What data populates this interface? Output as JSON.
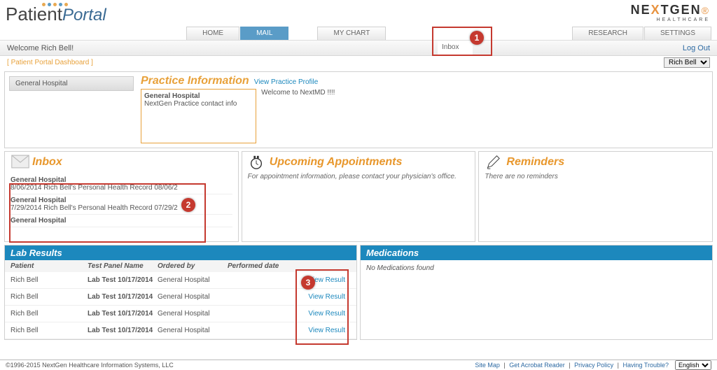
{
  "brand": {
    "nextgen": "NEXTGEN",
    "sub": "HEALTHCARE",
    "logo_patient": "Patient",
    "logo_portal": "Portal"
  },
  "nav": {
    "home": "HOME",
    "mail": "MAIL",
    "mychart": "MY CHART",
    "research": "RESEARCH",
    "settings": "SETTINGS",
    "inbox_sub": "Inbox"
  },
  "welcome": {
    "text": "Welcome Rich Bell!",
    "logout": "Log Out"
  },
  "breadcrumb": {
    "open": "[ ",
    "label": "Patient Portal Dashboard",
    "close": " ]",
    "user": "Rich Bell"
  },
  "practice": {
    "tab": "General Hospital",
    "title": "Practice Information",
    "view_link": "View Practice Profile",
    "card_title": "General Hospital",
    "card_body": "NextGen Practice contact info",
    "welcome_msg": "Welcome to NextMD !!!!"
  },
  "panels": {
    "inbox": {
      "title": "Inbox",
      "items": [
        {
          "title": "General Hospital",
          "sub": "8/06/2014    Rich Bell's Personal Health Record 08/06/2"
        },
        {
          "title": "General Hospital",
          "sub": "7/29/2014    Rich Bell's Personal Health Record 07/29/2"
        },
        {
          "title": "General Hospital",
          "sub": ""
        }
      ]
    },
    "appt": {
      "title": "Upcoming Appointments",
      "body": "For appointment information, please contact your physician's office."
    },
    "rem": {
      "title": "Reminders",
      "body": "There are no reminders"
    }
  },
  "labs": {
    "header": "Lab Results",
    "cols": {
      "patient": "Patient",
      "panel": "Test Panel Name",
      "ordered": "Ordered by",
      "performed": "Performed date",
      "action": ""
    },
    "view": "View Result",
    "rows": [
      {
        "patient": "Rich Bell",
        "panel": "Lab Test 10/17/2014",
        "ordered": "General Hospital",
        "performed": ""
      },
      {
        "patient": "Rich Bell",
        "panel": "Lab Test 10/17/2014",
        "ordered": "General Hospital",
        "performed": ""
      },
      {
        "patient": "Rich Bell",
        "panel": "Lab Test 10/17/2014",
        "ordered": "General Hospital",
        "performed": ""
      },
      {
        "patient": "Rich Bell",
        "panel": "Lab Test 10/17/2014",
        "ordered": "General Hospital",
        "performed": ""
      }
    ]
  },
  "meds": {
    "header": "Medications",
    "none": "No Medications found"
  },
  "footer": {
    "copy": "©1996-2015 NextGen Healthcare Information Systems, LLC",
    "sitemap": "Site Map",
    "acrobat": "Get Acrobat Reader",
    "privacy": "Privacy Policy",
    "trouble": "Having Trouble?",
    "lang": "English"
  },
  "annotations": {
    "a1": "1",
    "a2": "2",
    "a3": "3"
  }
}
